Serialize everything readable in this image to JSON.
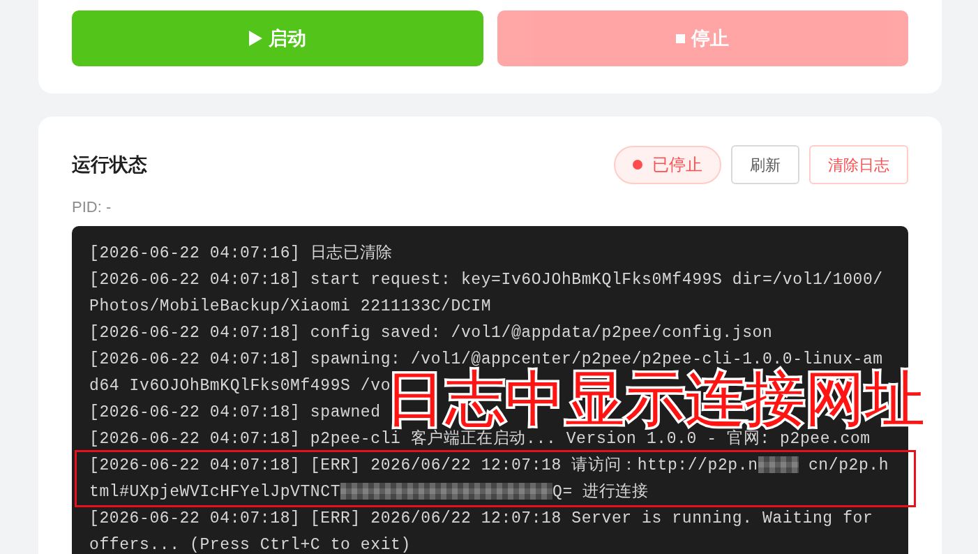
{
  "controls": {
    "buttons": [
      {
        "kind": "start",
        "label": "启动",
        "disabled": false
      },
      {
        "kind": "stop",
        "label": "停止",
        "disabled": true
      }
    ]
  },
  "status_panel": {
    "title": "运行状态",
    "status": {
      "running": false,
      "label": "已停止"
    },
    "actions": [
      {
        "kind": "neutral",
        "label": "刷新"
      },
      {
        "kind": "danger",
        "label": "清除日志"
      }
    ],
    "pid": "PID: -",
    "log": [
      {
        "text": "[2026-06-22 04:07:16] 日志已清除",
        "highlighted": false
      },
      {
        "text": "[2026-06-22 04:07:18] start request: key=Iv6OJOhBmKQlFks0Mf499S dir=/vol1/1000/",
        "highlighted": false
      },
      {
        "text": "Photos/MobileBackup/Xiaomi 2211133C/DCIM",
        "highlighted": false
      },
      {
        "text": "[2026-06-22 04:07:18] config saved: /vol1/@appdata/p2pee/config.json",
        "highlighted": false
      },
      {
        "text": "[2026-06-22 04:07:18] spawning: /vol1/@appcenter/p2pee/p2pee-cli-1.0.0-linux-am",
        "highlighted": false
      },
      {
        "text": "d64 Iv6OJOhBmKQlFks0Mf499S /vo",
        "highlighted": false
      },
      {
        "text": "[2026-06-22 04:07:18] spawned",
        "highlighted": false
      },
      {
        "text": "[2026-06-22 04:07:18] p2pee-cli 客户端正在启动... Version 1.0.0 - 官网: p2pee.com",
        "highlighted": false
      },
      {
        "segments": [
          {
            "kind": "text",
            "text": "[2026-06-22 04:07:18] [ERR] 2026/06/22 12:07:18 请访问：http://p2p.n"
          },
          {
            "kind": "redacted"
          },
          {
            "kind": "text",
            "text": " cn/p2p.h"
          }
        ],
        "highlighted": true
      },
      {
        "segments": [
          {
            "kind": "text",
            "text": "tml#UXpjeWVIcHFYelJpVTNCT"
          },
          {
            "kind": "redacted"
          },
          {
            "kind": "text",
            "text": "Q= 进行连接"
          }
        ],
        "highlighted": true
      },
      {
        "text": "[2026-06-22 04:07:18] [ERR] 2026/06/22 12:07:18 Server is running. Waiting for",
        "highlighted": false
      },
      {
        "text": "offers... (Press Ctrl+C to exit)",
        "highlighted": false
      }
    ],
    "callout": "日志中显示连接网址"
  }
}
